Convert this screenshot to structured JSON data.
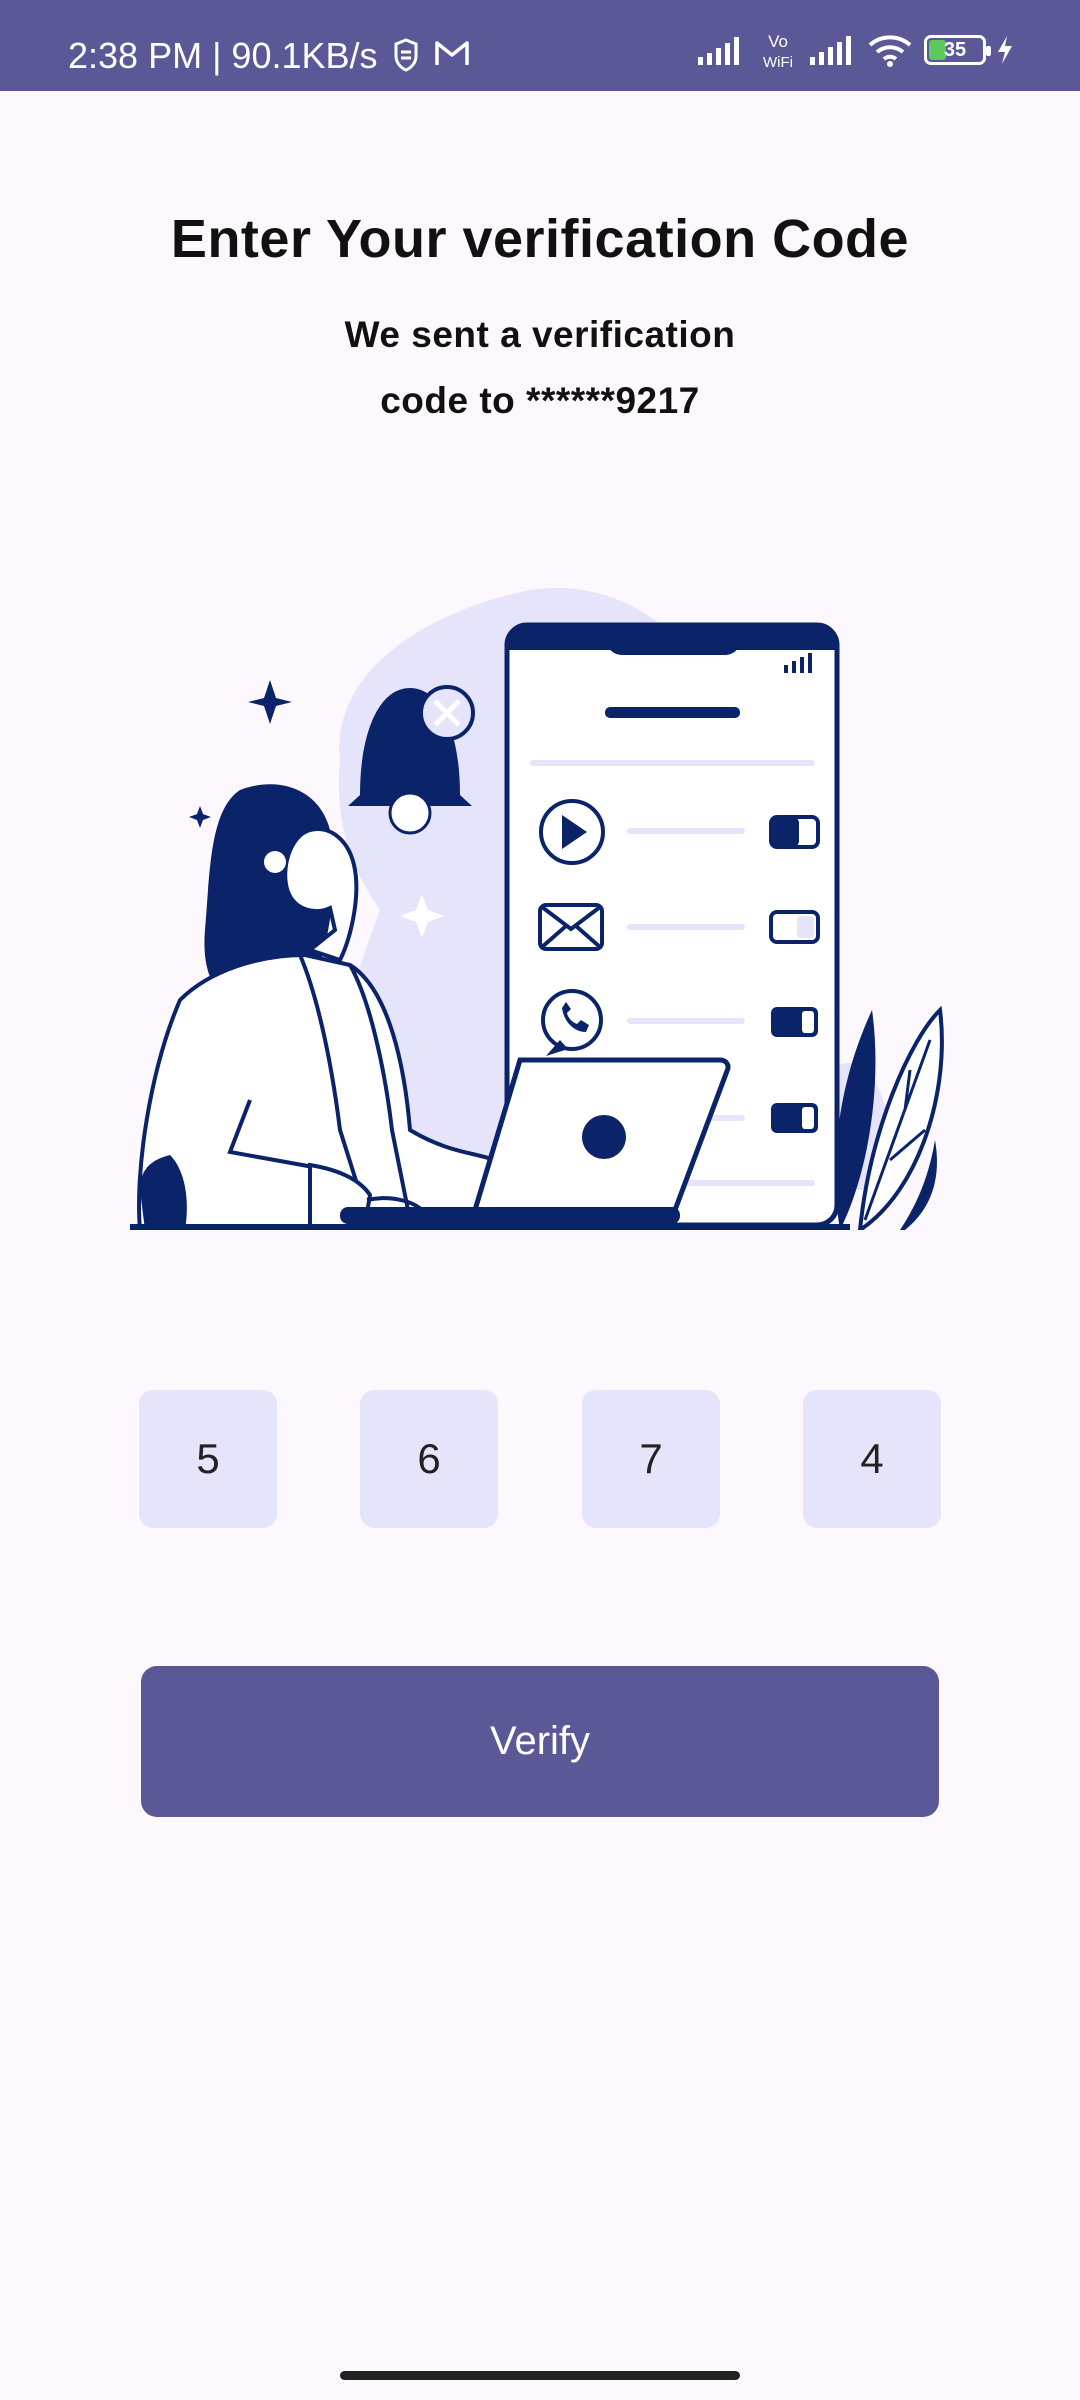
{
  "status_bar": {
    "time_speed": "2:38 PM | 90.1KB/s",
    "vowifi_label": "Vo\nWiFi",
    "battery_level": "35"
  },
  "screen": {
    "title": "Enter Your verification Code",
    "subtitle": "We sent a verification code to ******9217"
  },
  "otp": {
    "digits": [
      "5",
      "6",
      "7",
      "4"
    ]
  },
  "verify_button": {
    "label": "Verify"
  },
  "colors": {
    "primary": "#5b5898",
    "otp_box": "#e6e4fb",
    "illustration_navy": "#0b2469",
    "illustration_bg": "#e6e4fb",
    "background": "#fdf8fd"
  }
}
